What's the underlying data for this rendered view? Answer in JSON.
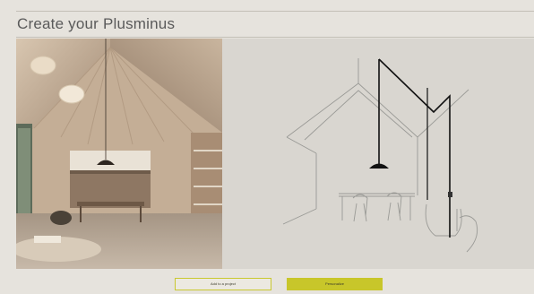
{
  "page": {
    "title": "Create your Plusminus"
  },
  "actions": {
    "add_to_project_label": "Add to a project",
    "personalize_label": "Personalize"
  },
  "colors": {
    "background": "#e6e3dd",
    "sketch_background": "#d9d6d0",
    "accent": "#c8c62a",
    "rule": "#c3bfb6",
    "title_text": "#5a5a5a"
  },
  "images": {
    "photo": "interior-photo",
    "sketch": "lamp-line-drawing"
  }
}
